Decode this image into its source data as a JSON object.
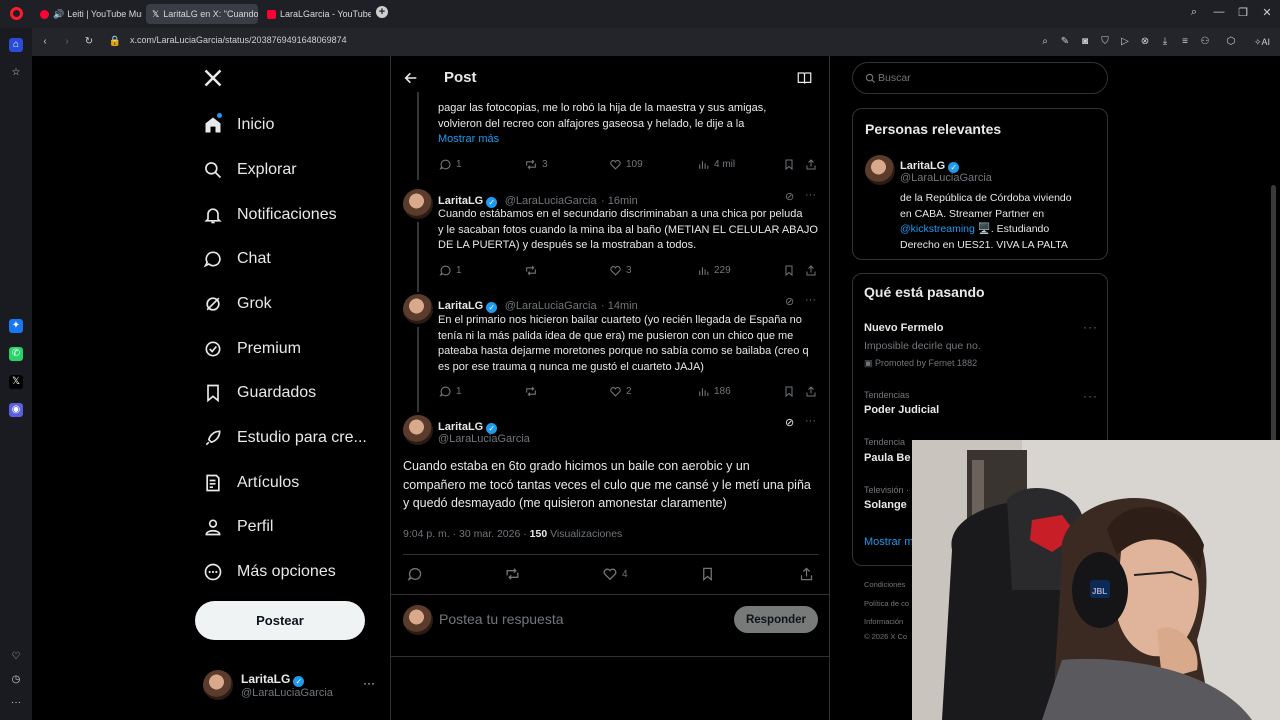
{
  "browser": {
    "tabs": [
      {
        "label": "Leiti | YouTube Music",
        "icon": "youtube-music-icon"
      },
      {
        "label": "LaritaLG en X: \"Cuando e",
        "icon": "x-logo-icon"
      },
      {
        "label": "LaraLGarcia - YouTube",
        "icon": "youtube-icon"
      }
    ],
    "url": "x.com/LaraLuciaGarcia/status/2038769491648069874",
    "ai_label": "AI"
  },
  "nav": {
    "items": [
      {
        "label": "Inicio",
        "icon": "home-icon"
      },
      {
        "label": "Explorar",
        "icon": "search-icon"
      },
      {
        "label": "Notificaciones",
        "icon": "bell-icon"
      },
      {
        "label": "Chat",
        "icon": "chat-icon"
      },
      {
        "label": "Grok",
        "icon": "grok-icon"
      },
      {
        "label": "Premium",
        "icon": "premium-icon"
      },
      {
        "label": "Guardados",
        "icon": "bookmark-icon"
      },
      {
        "label": "Estudio para cre...",
        "icon": "rocket-icon"
      },
      {
        "label": "Artículos",
        "icon": "articles-icon"
      },
      {
        "label": "Perfil",
        "icon": "profile-icon"
      },
      {
        "label": "Más opciones",
        "icon": "more-options-icon"
      }
    ],
    "post_button": "Postear",
    "account": {
      "name": "LaritaLG",
      "handle": "@LaraLuciaGarcia"
    }
  },
  "header": {
    "title": "Post"
  },
  "tweets": [
    {
      "text_lines": [
        "pagar las fotocopias, me lo robó la hija de la maestra y sus amigas,",
        "volvieron del recreo con alfajores gaseosa y helado, le dije a la"
      ],
      "show_more": "Mostrar más",
      "replies": "1",
      "retweets": "3",
      "likes": "109",
      "views": "4 mil"
    },
    {
      "name": "LaritaLG",
      "handle": "@LaraLuciaGarcia",
      "time": "· 16min",
      "text_lines": [
        "Cuando estábamos en el secundario discriminaban a una chica por peluda",
        "y le sacaban fotos cuando la mina iba al baño (METIAN EL CELULAR ABAJO",
        "DE LA PUERTA) y después se la mostraban a todos."
      ],
      "replies": "1",
      "retweets": "",
      "likes": "3",
      "views": "229"
    },
    {
      "name": "LaritaLG",
      "handle": "@LaraLuciaGarcia",
      "time": "· 14min",
      "text_lines": [
        "En el primario nos hicieron bailar cuarteto (yo recién llegada de España no",
        "tenía ni la más palida idea de que era) me pusieron con un chico que me",
        "pateaba hasta dejarme moretones porque no sabía como se bailaba (creo q",
        "es por ese trauma q nunca me gustó el cuarteto JAJA)"
      ],
      "replies": "1",
      "retweets": "",
      "likes": "2",
      "views": "186"
    }
  ],
  "main_tweet": {
    "name": "LaritaLG",
    "handle": "@LaraLuciaGarcia",
    "text_lines": [
      "Cuando estaba en 6to grado hicimos un baile con aerobic y un",
      "compañero me tocó tantas veces el culo que me cansé y le metí una piña",
      "y quedó desmayado (me quisieron amonestar claramente)"
    ],
    "timestamp": "9:04 p. m. · 30 mar. 2026 ·",
    "views_count": "150",
    "views_label": "Visualizaciones",
    "likes": "4"
  },
  "reply": {
    "placeholder": "Postea tu respuesta",
    "button": "Responder"
  },
  "search": {
    "placeholder": "Buscar"
  },
  "relevant": {
    "title": "Personas relevantes",
    "name": "LaritaLG",
    "handle": "@LaraLuciaGarcia",
    "bio_1": "de la República de Córdoba viviendo",
    "bio_2": "en CABA. Streamer Partner en",
    "bio_link": "@kickstreaming",
    "bio_3": ". Estudiando",
    "bio_4": "Derecho en UES21. VIVA LA PALTA"
  },
  "trends": {
    "title": "Qué está pasando",
    "items": [
      {
        "title": "Nuevo Fermelo",
        "sub": "Imposible decirle que no.",
        "promo": "Promoted by Fernet 1882"
      },
      {
        "meta": "Tendencias",
        "title": "Poder Judicial"
      },
      {
        "meta": "Tendencia",
        "title": "Paula Be"
      },
      {
        "meta": "Televisión ·",
        "title": "Solange"
      }
    ],
    "show_more": "Mostrar m"
  },
  "footer": [
    "Condiciones",
    "Política de co",
    "Información",
    "© 2026 X Co"
  ],
  "colors": {
    "accent": "#1d9bf0",
    "link": "#1d9bf0",
    "background": "#000000",
    "border": "#2f3336",
    "muted": "#71767b"
  }
}
